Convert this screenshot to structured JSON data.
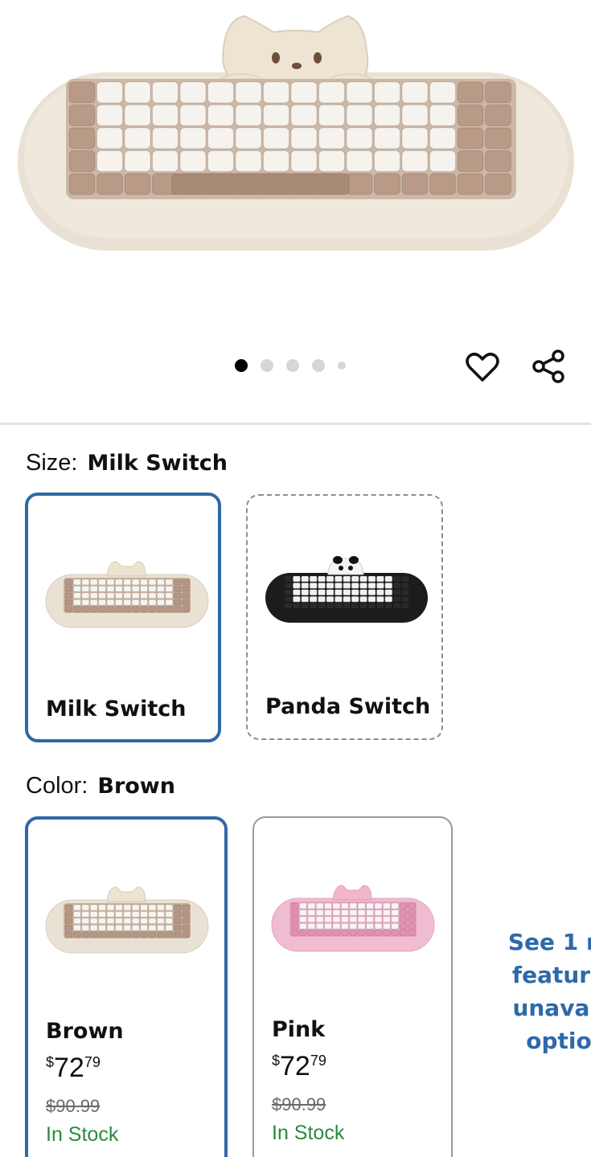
{
  "gallery": {
    "slide_count": 5,
    "active_slide": 1
  },
  "size": {
    "label": "Size:",
    "selected_value": "Milk Switch",
    "options": [
      {
        "name": "Milk Switch",
        "selected": true,
        "available": true
      },
      {
        "name": "Panda Switch",
        "selected": false,
        "available": false
      }
    ]
  },
  "color": {
    "label": "Color:",
    "selected_value": "Brown",
    "options": [
      {
        "name": "Brown",
        "price_currency": "$",
        "price_dollars": "72",
        "price_cents": "79",
        "was_price": "$90.99",
        "stock": "In Stock",
        "selected": true
      },
      {
        "name": "Pink",
        "price_currency": "$",
        "price_dollars": "72",
        "price_cents": "79",
        "was_price": "$90.99",
        "stock": "In Stock",
        "selected": false
      }
    ]
  },
  "see_more_text": "See 1 m\nfeature\nunavail\noptio",
  "colors": {
    "accent_blue": "#2e69a8",
    "in_stock_green": "#2b8a3e",
    "keyboard_cream": "#e8e1d3",
    "keycap_brown": "#b89a86",
    "keyboard_black": "#1c1c1c",
    "keyboard_pink": "#f0bcd1"
  },
  "icons": [
    "heart-icon",
    "share-icon"
  ]
}
